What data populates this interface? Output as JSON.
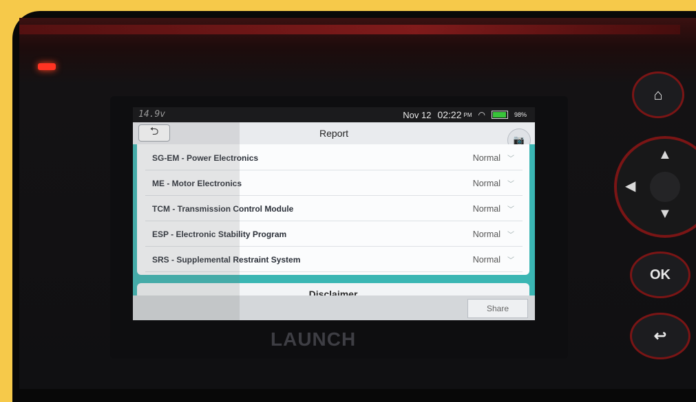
{
  "status_bar": {
    "voltage": "14.9v",
    "date": "Nov 12",
    "time": "02:22",
    "ampm": "PM",
    "battery": "98%"
  },
  "header": {
    "back_glyph": "⮌",
    "title": "Report",
    "camera_icon": "camera-icon"
  },
  "report_rows": [
    {
      "name": "SG-EM - Power Electronics",
      "status": "Normal"
    },
    {
      "name": "ME - Motor Electronics",
      "status": "Normal"
    },
    {
      "name": "TCM - Transmission Control Module",
      "status": "Normal"
    },
    {
      "name": "ESP - Electronic Stability Program",
      "status": "Normal"
    },
    {
      "name": "SRS - Supplemental Restraint System",
      "status": "Normal"
    }
  ],
  "disclaimer": {
    "label": "Disclaimer"
  },
  "bottom_bar": {
    "share_label": "Share"
  },
  "device": {
    "brand": "LAUNCH",
    "ok_label": "OK"
  },
  "colors": {
    "accent_teal": "#3ab6b3",
    "device_red": "#7a1515",
    "frame_yellow": "#f6c94a"
  }
}
